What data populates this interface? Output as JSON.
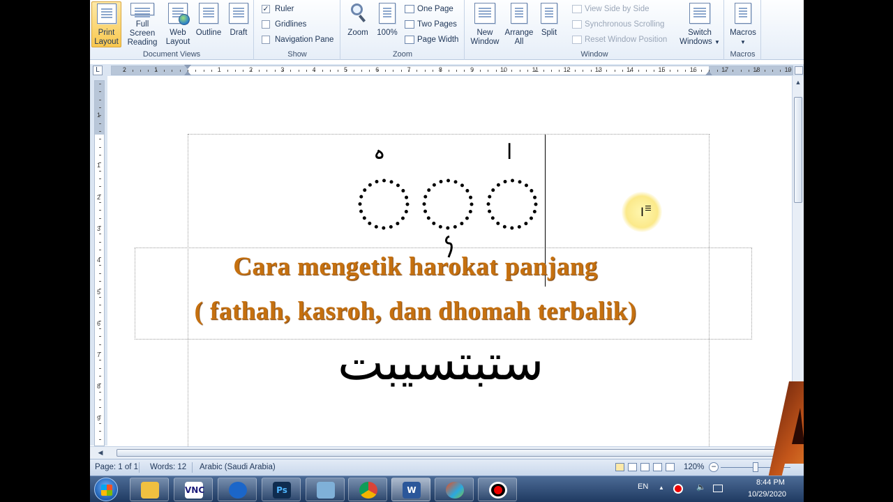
{
  "ribbon": {
    "document_views": {
      "label": "Document Views",
      "buttons": [
        {
          "line1": "Print",
          "line2": "Layout",
          "active": true
        },
        {
          "line1": "Full Screen",
          "line2": "Reading"
        },
        {
          "line1": "Web",
          "line2": "Layout"
        },
        {
          "line1": "Outline",
          "line2": ""
        },
        {
          "line1": "Draft",
          "line2": ""
        }
      ]
    },
    "show": {
      "label": "Show",
      "ruler": {
        "label": "Ruler",
        "checked": true
      },
      "gridlines": {
        "label": "Gridlines",
        "checked": false
      },
      "navigation_pane": {
        "label": "Navigation Pane",
        "checked": false
      }
    },
    "zoom": {
      "label": "Zoom",
      "zoom_button": "Zoom",
      "hundred_button": "100%",
      "one_page": "One Page",
      "two_pages": "Two Pages",
      "page_width": "Page Width"
    },
    "window": {
      "label": "Window",
      "new_window": {
        "line1": "New",
        "line2": "Window"
      },
      "arrange_all": {
        "line1": "Arrange",
        "line2": "All"
      },
      "split": "Split",
      "view_side_by_side": "View Side by Side",
      "synchronous_scrolling": "Synchronous Scrolling",
      "reset_window_position": "Reset Window Position",
      "switch_windows": {
        "line1": "Switch",
        "line2": "Windows"
      }
    },
    "macros": {
      "label": "Macros",
      "button": "Macros"
    }
  },
  "ruler": {
    "corner": "L",
    "numbers": [
      "2",
      "1",
      "1",
      "2",
      "3",
      "4",
      "5",
      "6",
      "7",
      "8",
      "9",
      "10",
      "11",
      "12",
      "13",
      "14",
      "15",
      "16",
      "17",
      "18",
      "19"
    ],
    "vertical_numbers": [
      "1",
      "1",
      "2",
      "3",
      "4",
      "5",
      "6",
      "7",
      "8",
      "9"
    ]
  },
  "document": {
    "top_marks": {
      "left": "ہ",
      "right": "ا"
    },
    "title_line1": "Cara mengetik harokat  panjang",
    "title_line2": "( fathah, kasroh, dan dhomah terbalik)",
    "arabic_word": "ستبتسيبت"
  },
  "status_bar": {
    "page": "Page: 1 of 1",
    "words": "Words: 12",
    "language": "Arabic (Saudi Arabia)",
    "zoom_level": "120%"
  },
  "taskbar": {
    "apps": [
      "windows-explorer",
      "vnc-viewer",
      "browser",
      "photoshop",
      "control-panel",
      "chrome",
      "word",
      "media",
      "recorder"
    ],
    "vnc_label": "VNC",
    "ps_label": "Ps",
    "word_label": "W",
    "language": "EN",
    "time": "8:44 PM",
    "date": "10/29/2020"
  },
  "colors": {
    "title_orange": "#c5700f",
    "ribbon_bg": "#e6eef8",
    "active_button": "#f9c84f",
    "taskbar": "#1f3a61"
  }
}
